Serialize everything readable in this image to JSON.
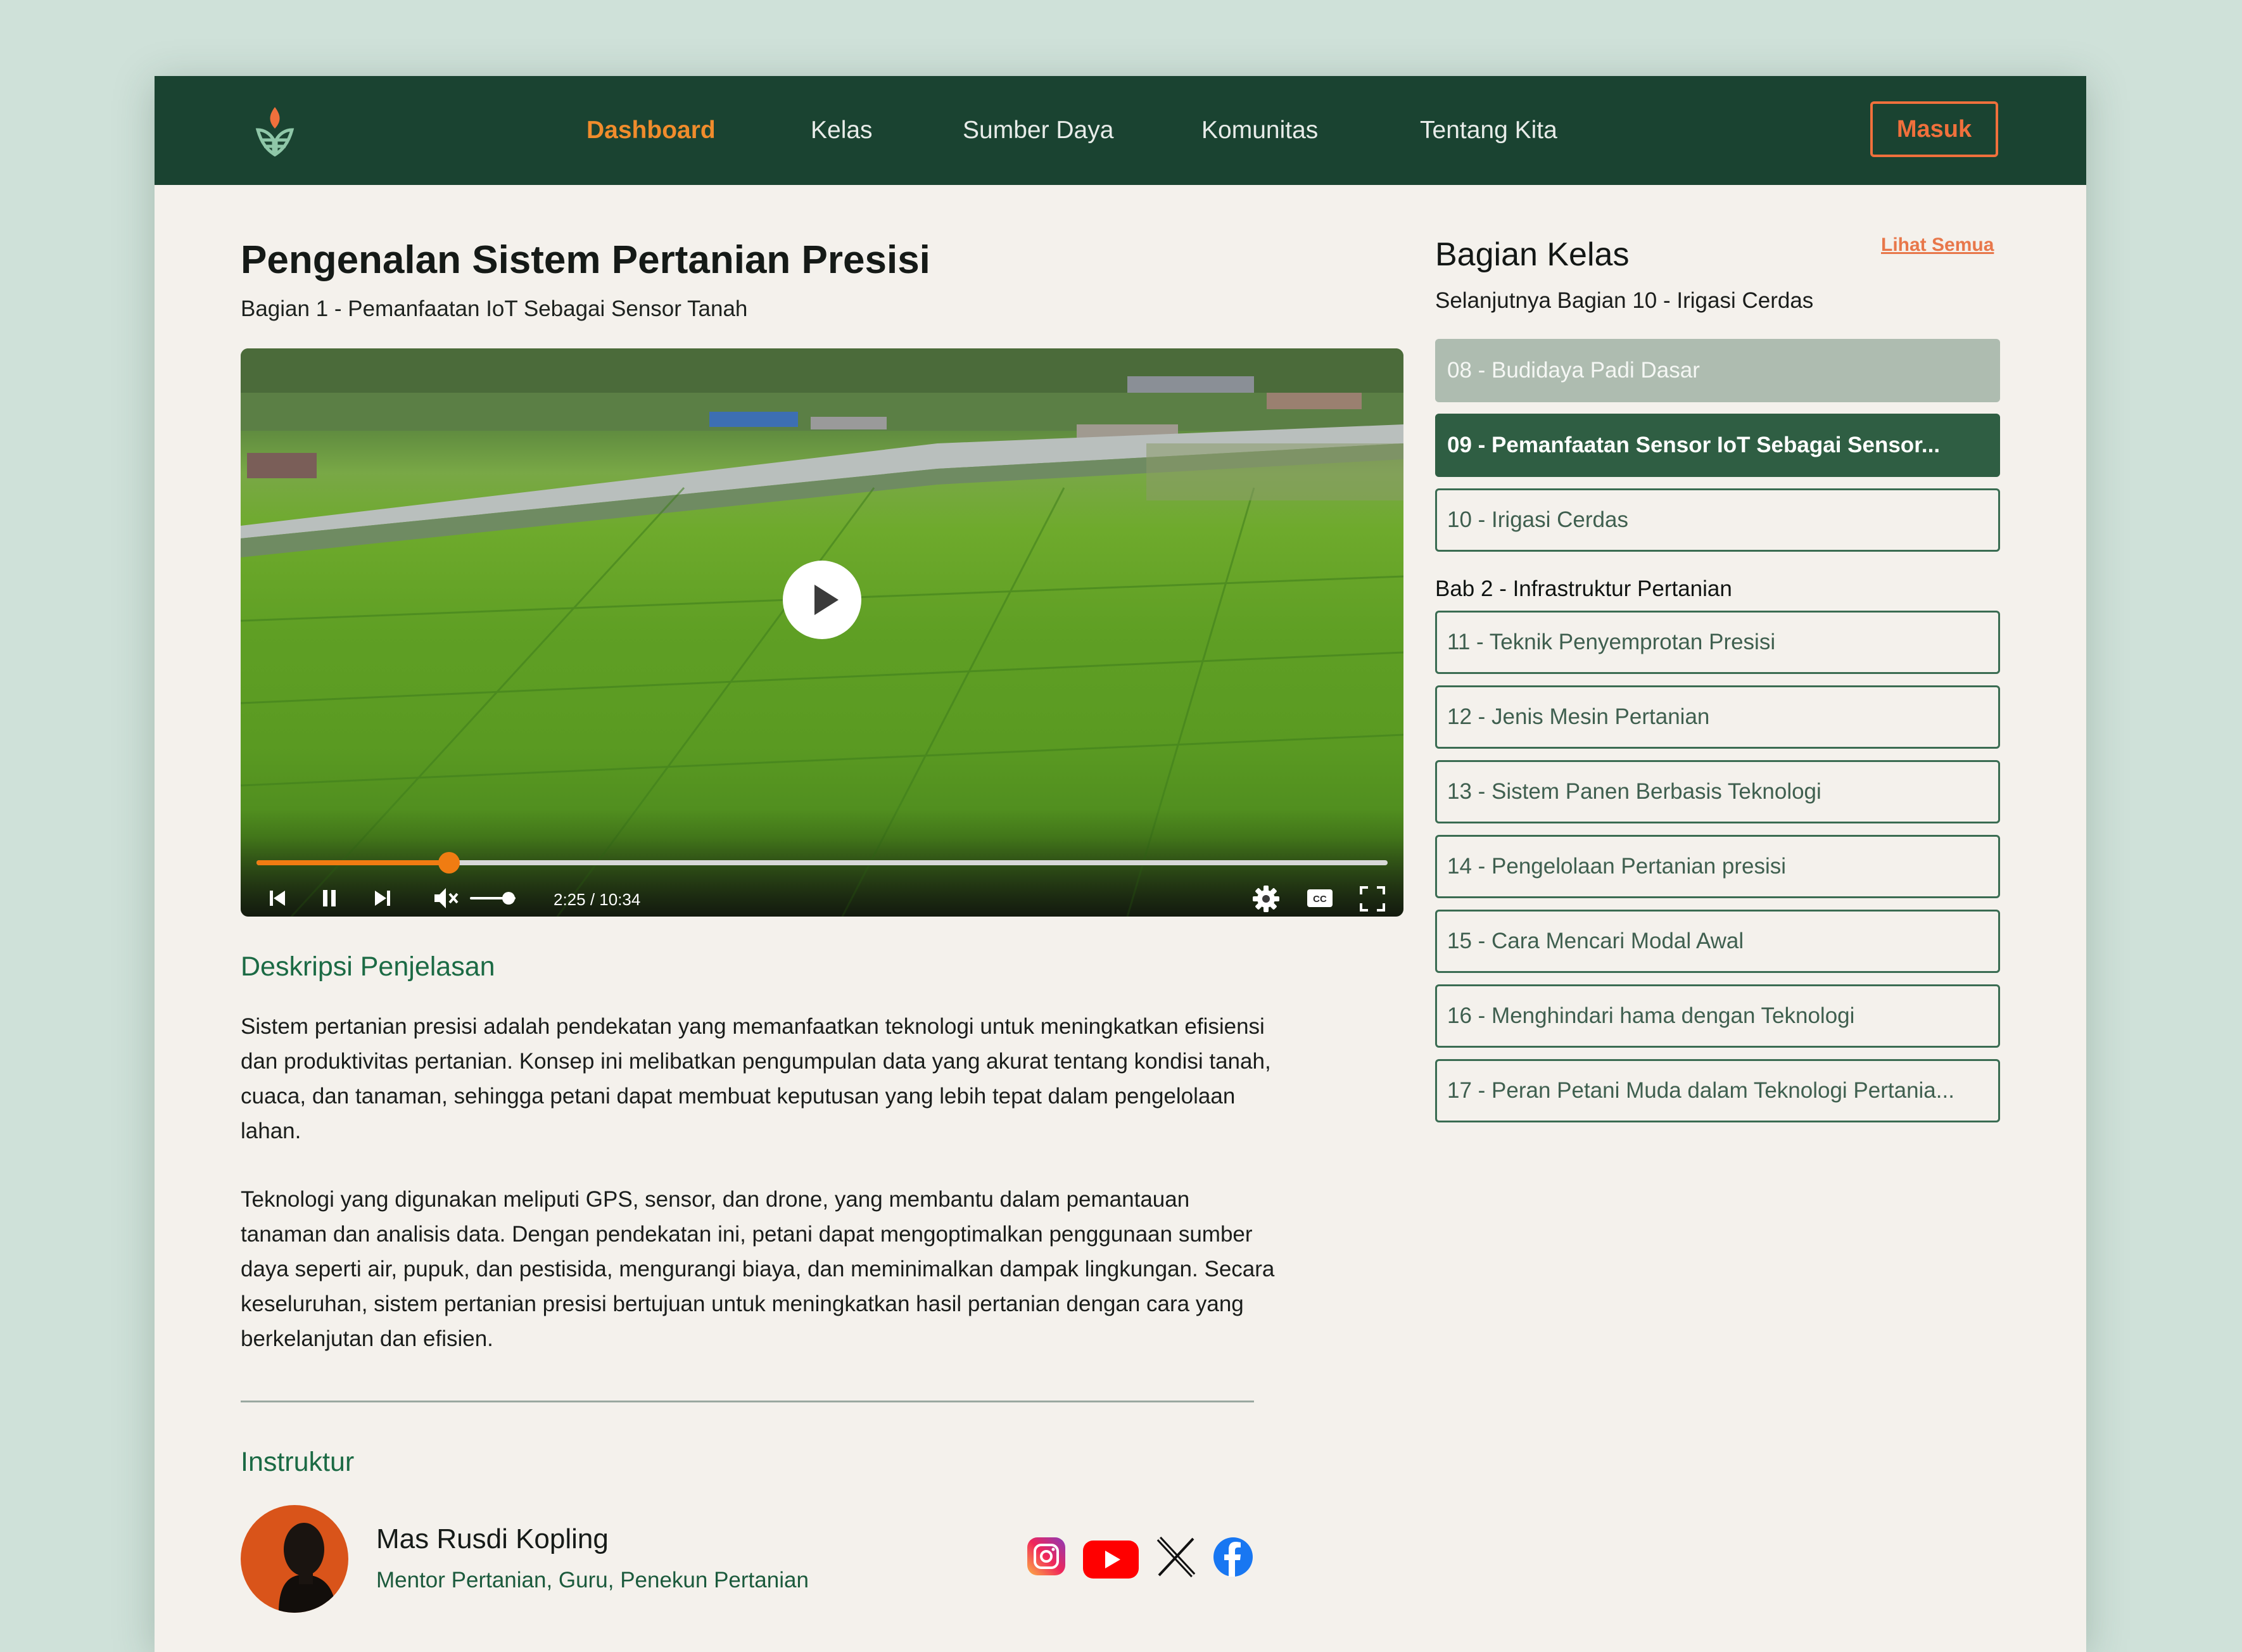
{
  "nav": {
    "items": [
      {
        "label": "Dashboard",
        "active": true
      },
      {
        "label": "Kelas",
        "active": false
      },
      {
        "label": "Sumber Daya",
        "active": false
      },
      {
        "label": "Komunitas",
        "active": false
      },
      {
        "label": "Tentang Kita",
        "active": false
      }
    ],
    "login_label": "Masuk",
    "colors": {
      "bar": "#1a4331",
      "active": "#f08c2c",
      "login": "#f0703c"
    }
  },
  "course": {
    "title": "Pengenalan Sistem Pertanian Presisi",
    "subtitle": "Bagian 1 - Pemanfaatan IoT Sebagai Sensor Tanah"
  },
  "video": {
    "time": "2:25 / 10:34",
    "progress": 0.17,
    "volume": 0.85,
    "icons": [
      "previous-icon",
      "pause-icon",
      "next-icon",
      "mute-icon",
      "settings-icon",
      "captions-icon",
      "fullscreen-icon",
      "play-icon"
    ]
  },
  "description": {
    "heading": "Deskripsi Penjelasan",
    "paragraphs": [
      "Sistem pertanian presisi adalah pendekatan yang memanfaatkan teknologi untuk meningkatkan efisiensi dan produktivitas pertanian. Konsep ini melibatkan pengumpulan data yang akurat tentang kondisi tanah, cuaca, dan tanaman, sehingga petani dapat membuat keputusan yang lebih tepat dalam pengelolaan lahan.",
      "Teknologi yang digunakan meliputi GPS, sensor, dan drone, yang membantu dalam pemantauan tanaman dan analisis data. Dengan pendekatan ini, petani dapat mengoptimalkan penggunaan sumber daya seperti air, pupuk, dan pestisida, mengurangi biaya, dan meminimalkan dampak lingkungan. Secara keseluruhan, sistem pertanian presisi bertujuan untuk meningkatkan hasil pertanian dengan cara yang berkelanjutan dan efisien."
    ]
  },
  "instructor": {
    "heading": "Instruktur",
    "name": "Mas Rusdi Kopling",
    "role": "Mentor Pertanian, Guru, Penekun Pertanian",
    "socials": [
      "instagram-icon",
      "youtube-icon",
      "x-icon",
      "facebook-icon"
    ]
  },
  "sidebar": {
    "title": "Bagian Kelas",
    "subtitle": "Selanjutnya Bagian 10 - Irigasi Cerdas",
    "see_all": "Lihat Semua",
    "lessons_top": [
      {
        "label": "08 - Budidaya Padi Dasar",
        "state": "done"
      },
      {
        "label": "09 - Pemanfaatan Sensor IoT Sebagai Sensor...",
        "state": "current"
      },
      {
        "label": "10 - Irigasi Cerdas",
        "state": "upcoming"
      }
    ],
    "chapter_label": "Bab 2 - Infrastruktur Pertanian",
    "lessons_bottom": [
      {
        "label": "11 - Teknik Penyemprotan Presisi"
      },
      {
        "label": "12 - Jenis Mesin Pertanian"
      },
      {
        "label": "13 - Sistem Panen Berbasis Teknologi"
      },
      {
        "label": "14 - Pengelolaan Pertanian presisi"
      },
      {
        "label": "15 - Cara Mencari Modal Awal"
      },
      {
        "label": "16 - Menghindari hama dengan Teknologi"
      },
      {
        "label": "17 - Peran Petani Muda dalam Teknologi Pertania..."
      }
    ]
  }
}
